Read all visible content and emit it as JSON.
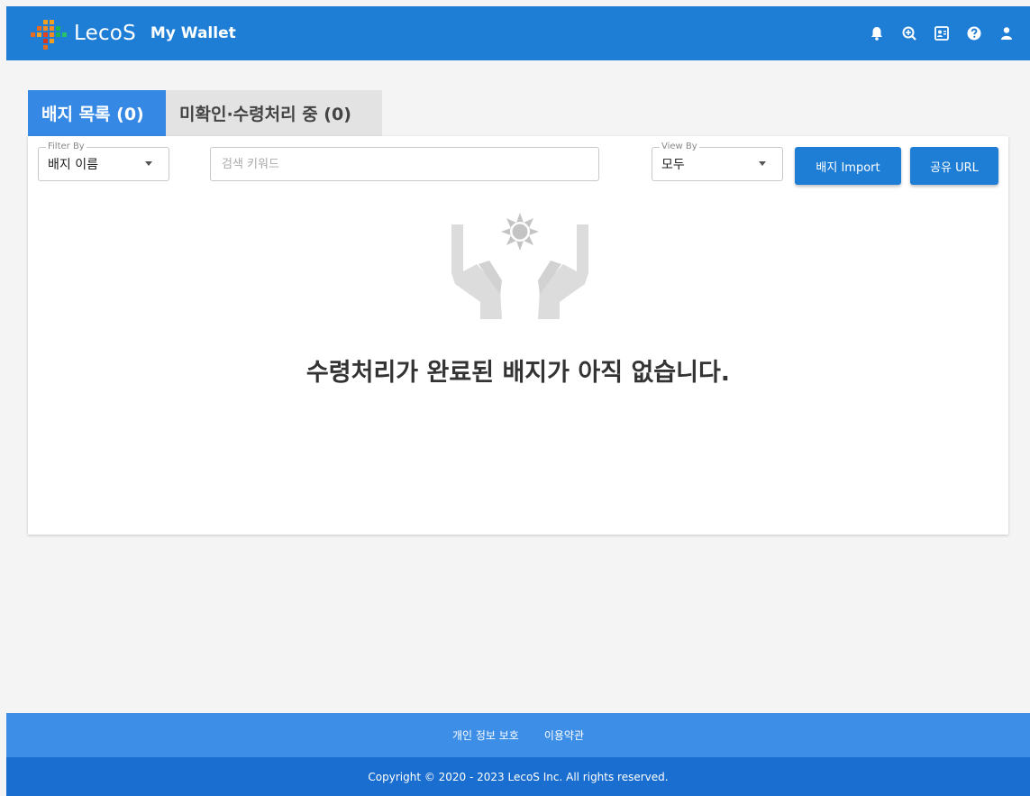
{
  "header": {
    "brand": "LecoS",
    "app_title": "My Wallet",
    "icons": [
      "bell-icon",
      "badge-search-icon",
      "id-card-icon",
      "help-icon",
      "user-icon"
    ]
  },
  "tabs": [
    {
      "label": "배지 목록 (0)",
      "active": true
    },
    {
      "label": "미확인·수령처리 중 (0)",
      "active": false
    }
  ],
  "filters": {
    "filter_by_label": "Filter By",
    "filter_by_value": "배지 이름",
    "search_placeholder": "검색 키워드",
    "view_by_label": "View By",
    "view_by_value": "모두"
  },
  "buttons": {
    "import": "배지 Import",
    "share": "공유 URL"
  },
  "empty_state": {
    "message": "수령처리가 완료된 배지가 아직 없습니다."
  },
  "footer": {
    "links": [
      "개인 정보 보호",
      "이용약관"
    ],
    "copyright": "Copyright © 2020 - 2023 LecoS Inc. All rights reserved."
  },
  "colors": {
    "primary": "#1e7ed6",
    "tab_active": "#3589e4",
    "footer_top": "#3d8ee6",
    "footer_bottom": "#1a6ecf"
  }
}
